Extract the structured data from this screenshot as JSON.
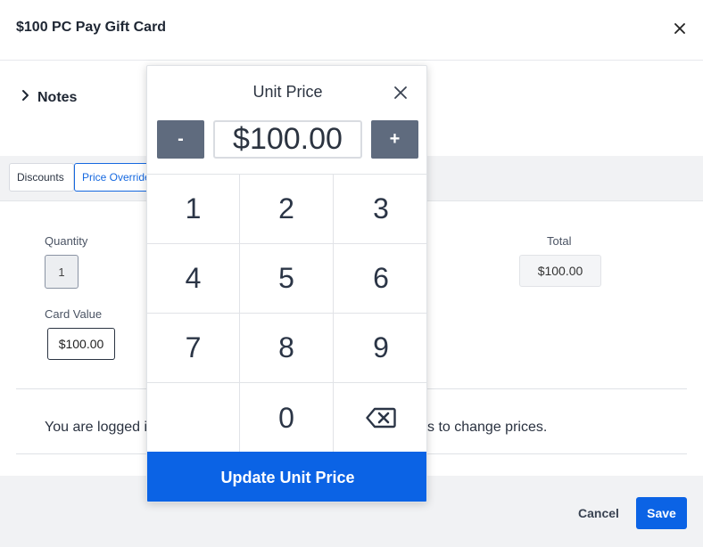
{
  "modal": {
    "title": "$100 PC Pay Gift Card",
    "close_icon": "close-icon",
    "notes_label": "Notes",
    "tabs": [
      {
        "label": "Discounts"
      },
      {
        "label": "Price Override"
      }
    ],
    "fields": {
      "quantity_label": "Quantity",
      "quantity_value": "1",
      "card_value_label": "Card Value",
      "card_value": "$100.00",
      "total_label": "Total",
      "total_value": "$100.00"
    },
    "message_left": "You are logged i",
    "message_right": "s to change prices.",
    "footer": {
      "cancel_label": "Cancel",
      "save_label": "Save"
    }
  },
  "keypad": {
    "title": "Unit Price",
    "minus_label": "-",
    "plus_label": "+",
    "value": "$100.00",
    "keys": [
      "1",
      "2",
      "3",
      "4",
      "5",
      "6",
      "7",
      "8",
      "9",
      "",
      "0",
      "backspace"
    ],
    "update_label": "Update Unit Price"
  },
  "colors": {
    "accent": "#0b63e5",
    "stepper": "#5f6b7e",
    "text": "#222b38"
  }
}
